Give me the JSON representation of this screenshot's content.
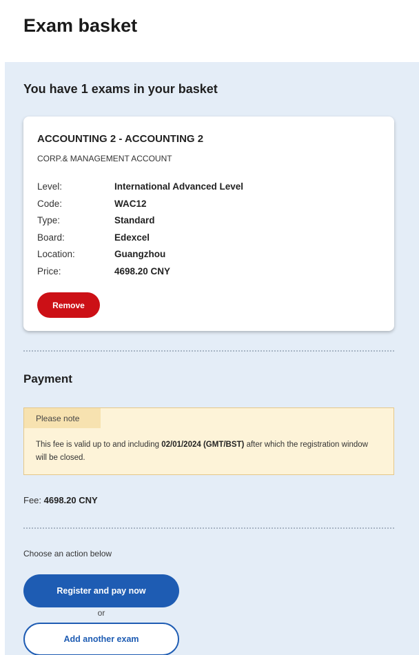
{
  "page": {
    "title": "Exam basket"
  },
  "basket": {
    "heading": "You have 1 exams in your basket",
    "exams": [
      {
        "title": "ACCOUNTING 2 - ACCOUNTING 2",
        "subtitle": "CORP.& MANAGEMENT ACCOUNT",
        "details": [
          {
            "label": "Level:",
            "value": "International Advanced Level"
          },
          {
            "label": "Code:",
            "value": "WAC12"
          },
          {
            "label": "Type:",
            "value": "Standard"
          },
          {
            "label": "Board:",
            "value": "Edexcel"
          },
          {
            "label": "Location:",
            "value": "Guangzhou"
          },
          {
            "label": "Price:",
            "value": "4698.20 CNY"
          }
        ],
        "remove_label": "Remove"
      }
    ]
  },
  "payment": {
    "heading": "Payment",
    "note": {
      "label": "Please note",
      "text_before": "This fee is valid up to and including ",
      "date": "02/01/2024",
      "timezone": "(GMT/BST)",
      "text_after": " after which the registration window will be closed."
    },
    "fee_label": "Fee: ",
    "fee_value": "4698.20 CNY"
  },
  "actions": {
    "prompt": "Choose an action below",
    "primary_label": "Register and pay now",
    "or_text": "or",
    "secondary_label": "Add another exam"
  },
  "colors": {
    "panel_bg": "#e4edf7",
    "remove_red": "#cc1016",
    "primary_blue": "#1e5cb3",
    "note_bg": "#fdf3d8"
  }
}
